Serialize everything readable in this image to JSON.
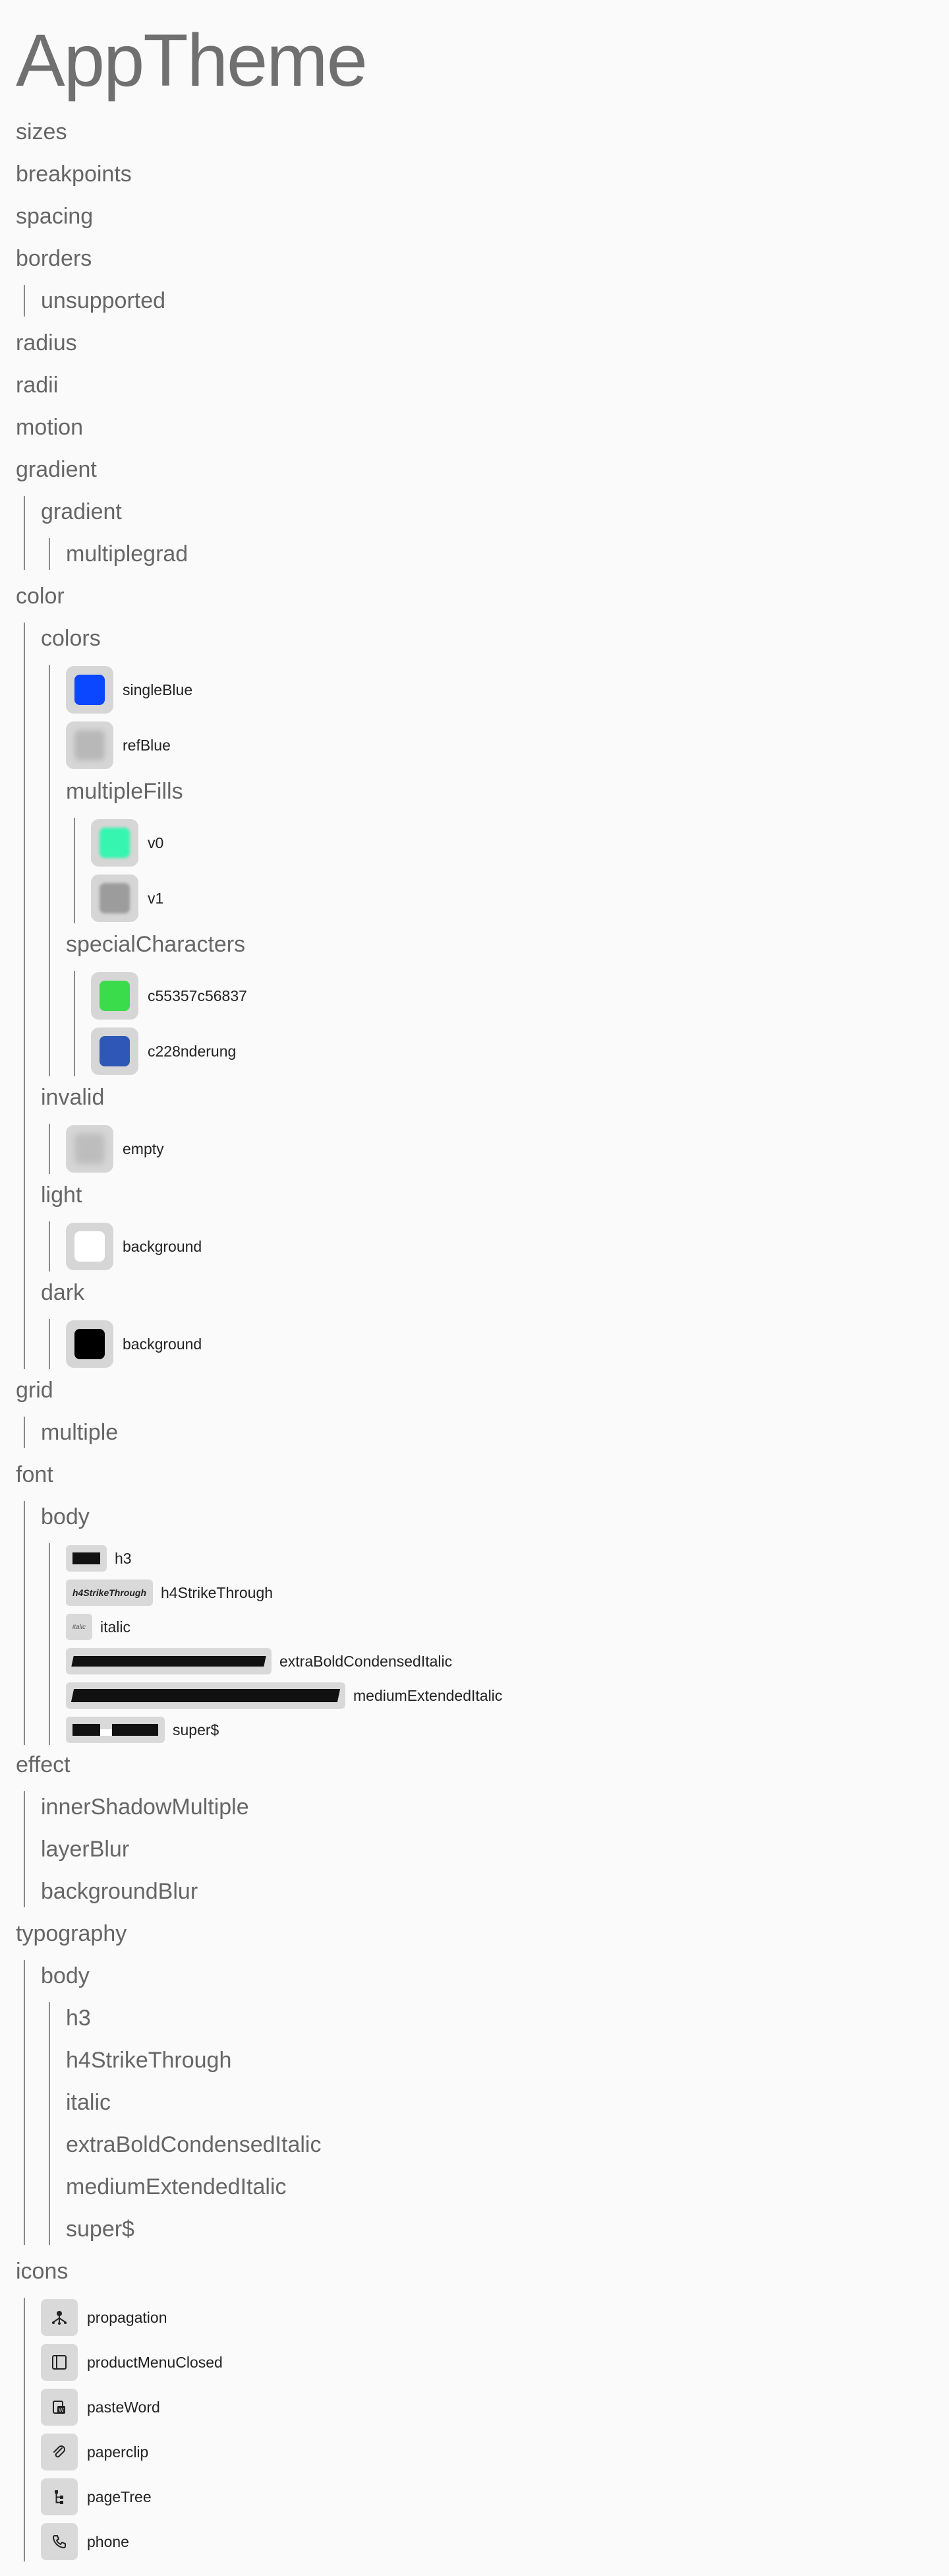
{
  "title": "AppTheme",
  "sections": {
    "sizes": "sizes",
    "breakpoints": "breakpoints",
    "spacing": "spacing",
    "borders": {
      "label": "borders",
      "children": [
        "unsupported"
      ]
    },
    "radius": "radius",
    "radii": "radii",
    "motion": "motion",
    "gradient": {
      "label": "gradient",
      "child": "gradient",
      "grandchild": "multiplegrad"
    },
    "color": {
      "label": "color",
      "colors": {
        "label": "colors",
        "swatches": [
          {
            "name": "singleBlue",
            "color": "#0a47ff"
          },
          {
            "name": "refBlue",
            "color": "#b8b8b8"
          }
        ],
        "multipleFills": {
          "label": "multipleFills",
          "swatches": [
            {
              "name": "v0",
              "color": "#36f5b0"
            },
            {
              "name": "v1",
              "color": "#9c9c9c"
            }
          ]
        },
        "specialCharacters": {
          "label": "specialCharacters",
          "swatches": [
            {
              "name": "c55357c56837",
              "color": "#3bdc4c"
            },
            {
              "name": "c228nderung",
              "color": "#2e57b8"
            }
          ]
        }
      },
      "invalid": {
        "label": "invalid",
        "swatches": [
          {
            "name": "empty",
            "color": "#bdbdbd"
          }
        ]
      },
      "light": {
        "label": "light",
        "swatches": [
          {
            "name": "background",
            "color": "#ffffff"
          }
        ]
      },
      "dark": {
        "label": "dark",
        "swatches": [
          {
            "name": "background",
            "color": "#000000"
          }
        ]
      }
    },
    "grid": {
      "label": "grid",
      "children": [
        "multiple"
      ]
    },
    "font": {
      "label": "font",
      "body": {
        "label": "body",
        "items": [
          {
            "name": "h3"
          },
          {
            "name": "h4StrikeThrough",
            "sample": "h4StrikeThrough"
          },
          {
            "name": "italic",
            "sample": "italic"
          },
          {
            "name": "extraBoldCondensedItalic"
          },
          {
            "name": "mediumExtendedItalic"
          },
          {
            "name": "super$"
          }
        ]
      }
    },
    "effect": {
      "label": "effect",
      "children": [
        "innerShadowMultiple",
        "layerBlur",
        "backgroundBlur"
      ]
    },
    "typography": {
      "label": "typography",
      "body": {
        "label": "body",
        "items": [
          "h3",
          "h4StrikeThrough",
          "italic",
          "extraBoldCondensedItalic",
          "mediumExtendedItalic",
          "super$"
        ]
      }
    },
    "icons": {
      "label": "icons",
      "items": [
        {
          "name": "propagation",
          "icon": "propagation-icon"
        },
        {
          "name": "productMenuClosed",
          "icon": "product-menu-closed-icon"
        },
        {
          "name": "pasteWord",
          "icon": "paste-word-icon"
        },
        {
          "name": "paperclip",
          "icon": "paperclip-icon"
        },
        {
          "name": "pageTree",
          "icon": "page-tree-icon"
        },
        {
          "name": "phone",
          "icon": "phone-icon"
        }
      ]
    }
  }
}
